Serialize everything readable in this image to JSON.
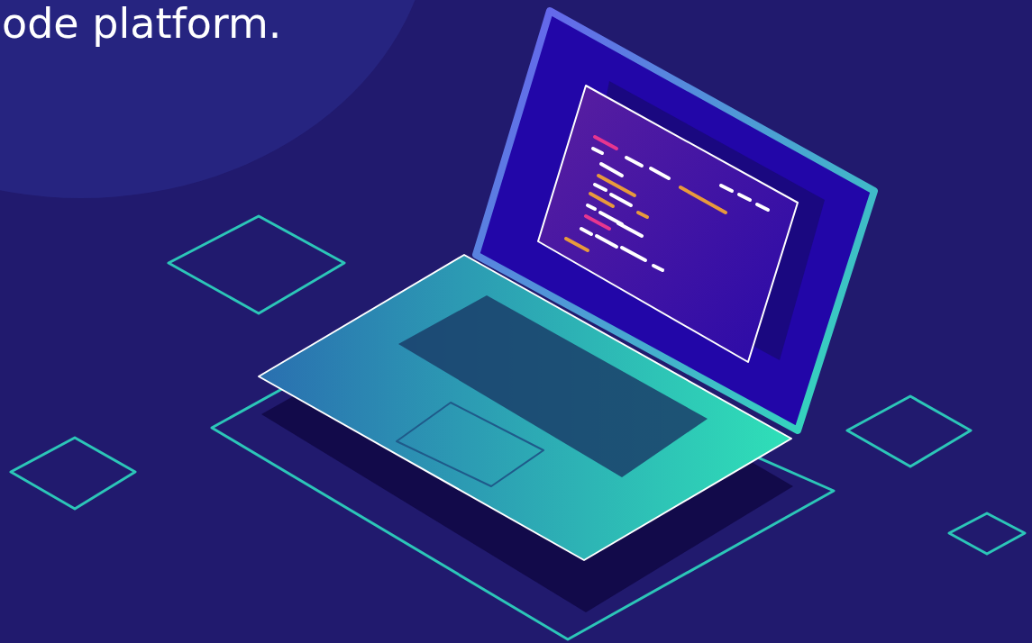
{
  "hero": {
    "heading": "ode platform."
  }
}
